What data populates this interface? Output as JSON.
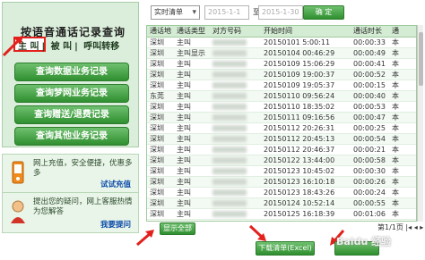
{
  "sidebar": {
    "title": "按语音通话记录查询",
    "modes": [
      "主 叫",
      "被 叫",
      "呼叫转移"
    ],
    "menu": [
      "查询数据业务记录",
      "查询梦网业务记录",
      "查询赠送/退费记录",
      "查询其他业务记录"
    ],
    "promo1": {
      "text": "网上充值，安全便捷，优惠多多",
      "link": "试试充值"
    },
    "promo2": {
      "text": "提出您的疑问，网上客服热情为您解答",
      "link": "我要提问"
    }
  },
  "toolbar": {
    "select_value": "实时清单",
    "date_from": "2015-1-1",
    "to_label": "至",
    "date_to": "2015-1-30",
    "ok_label": "确 定"
  },
  "table": {
    "headers": [
      "通话地",
      "通话类型",
      "对方号码",
      "开始时间",
      "通话时长",
      "通"
    ],
    "rows": [
      [
        "深圳",
        "主叫",
        "",
        "20150101 5:00:11",
        "00:00:33",
        "本"
      ],
      [
        "深圳",
        "主叫显示",
        "",
        "20150104 00:46:29",
        "00:00:49",
        "本"
      ],
      [
        "深圳",
        "主叫",
        "",
        "20150109 15:06:29",
        "00:00:41",
        "本"
      ],
      [
        "深圳",
        "主叫",
        "",
        "20150109 19:00:37",
        "00:00:52",
        "本"
      ],
      [
        "深圳",
        "主叫",
        "",
        "20150109 19:05:37",
        "00:00:15",
        "本"
      ],
      [
        "东莞",
        "主叫",
        "",
        "20150110 09:56:24",
        "00:00:40",
        "本"
      ],
      [
        "深圳",
        "主叫",
        "",
        "20150110 18:35:02",
        "00:00:53",
        "本"
      ],
      [
        "深圳",
        "主叫",
        "",
        "20150111 09:16:56",
        "00:00:47",
        "本"
      ],
      [
        "深圳",
        "主叫",
        "",
        "20150112 20:26:31",
        "00:00:25",
        "本"
      ],
      [
        "深圳",
        "主叫",
        "",
        "20150112 20:45:13",
        "00:00:54",
        "本"
      ],
      [
        "深圳",
        "主叫",
        "",
        "20150112 20:46:37",
        "00:00:21",
        "本"
      ],
      [
        "深圳",
        "主叫",
        "",
        "20150122 13:44:00",
        "00:00:58",
        "本"
      ],
      [
        "深圳",
        "主叫",
        "",
        "20150123 10:45:02",
        "00:00:30",
        "本"
      ],
      [
        "深圳",
        "主叫",
        "",
        "20150123 16:10:18",
        "00:00:26",
        "本"
      ],
      [
        "深圳",
        "主叫",
        "",
        "20150123 18:43:26",
        "00:00:24",
        "本"
      ],
      [
        "深圳",
        "主叫",
        "",
        "20150124 10:52:14",
        "00:00:55",
        "本"
      ],
      [
        "深圳",
        "主叫",
        "",
        "20150125 16:18:39",
        "00:01:06",
        "本"
      ]
    ]
  },
  "footer": {
    "show_all": "显示全部",
    "pagination": "第1/1页",
    "download": "下载清单(Excel)",
    "download_detail": "",
    "watermark": "Baidu 经验"
  }
}
